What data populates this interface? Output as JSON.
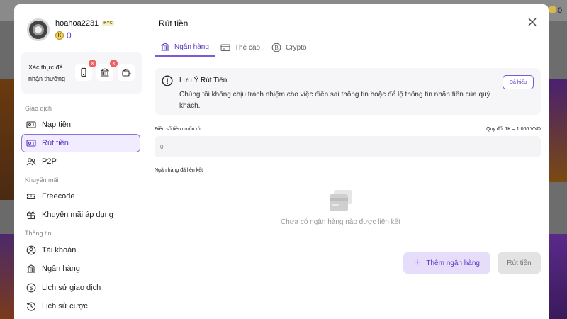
{
  "background": {
    "coin_balance": "0"
  },
  "user": {
    "username": "hoahoa2231",
    "kyc_badge": "KYC",
    "balance": "0",
    "coin_symbol": "K"
  },
  "verify": {
    "label": "Xác thực để nhận thưởng"
  },
  "sidebar": {
    "section_transactions": "Giao dịch",
    "deposit": "Nạp tiền",
    "withdraw": "Rút tiền",
    "p2p": "P2P",
    "section_promotions": "Khuyến mãi",
    "freecode": "Freecode",
    "applied_promos": "Khuyến mãi áp dụng",
    "section_info": "Thông tin",
    "account": "Tài khoản",
    "bank": "Ngân hàng",
    "transaction_history": "Lịch sử giao dịch",
    "bet_history": "Lịch sử cược"
  },
  "main": {
    "title": "Rút tiền",
    "tabs": [
      {
        "label": "Ngân hàng",
        "icon": "bank-icon"
      },
      {
        "label": "Thẻ cào",
        "icon": "card-icon"
      },
      {
        "label": "Crypto",
        "icon": "bitcoin-icon"
      }
    ],
    "notice_title": "Lưu Ý Rút Tiền",
    "notice_text": "Chúng tôi không chịu trách nhiệm cho việc điền sai thông tin hoặc để lộ thông tin nhận tiền của quý khách.",
    "ack_button": "Đã hiểu",
    "amount_label": "Điền số tiền muốn rút",
    "rate_label": "Quy đổi 1K = 1,000 VND",
    "amount_placeholder": "0",
    "linked_label": "Ngân hàng đã liên kết",
    "empty_text": "Chưa có ngân hàng nào được liên kết",
    "add_bank_button": "Thêm ngân hàng",
    "withdraw_button": "Rút tiền"
  },
  "colors": {
    "accent": "#5a36c0",
    "accent_light": "#e6ddfb",
    "badge_red": "#ef6060"
  }
}
